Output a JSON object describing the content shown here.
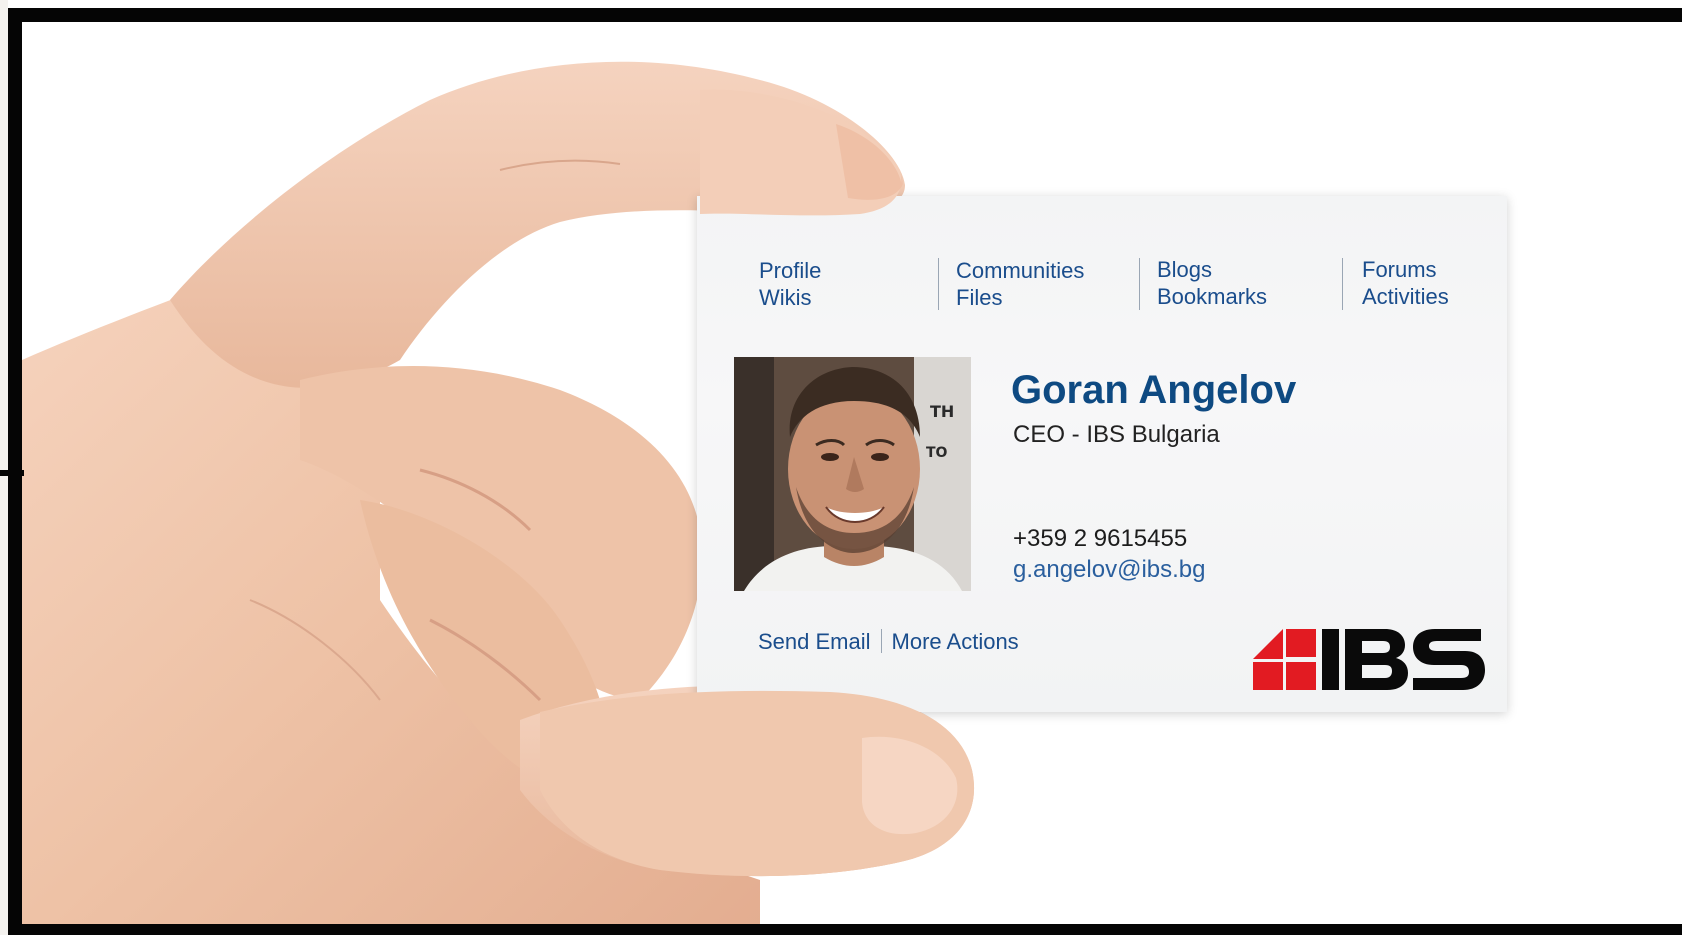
{
  "card": {
    "nav_links": [
      {
        "label": "Profile"
      },
      {
        "label": "Wikis"
      },
      {
        "label": "Communities"
      },
      {
        "label": "Files"
      },
      {
        "label": "Blogs"
      },
      {
        "label": "Bookmarks"
      },
      {
        "label": "Forums"
      },
      {
        "label": "Activities"
      }
    ],
    "person": {
      "name": "Goran Angelov",
      "title": "CEO - IBS Bulgaria",
      "phone": "+359 2 9615455",
      "email": "g.angelov@ibs.bg",
      "photo_icon": "person-photo"
    },
    "actions": {
      "send_email": "Send Email",
      "more_actions": "More Actions"
    },
    "logo": {
      "text": "IBS",
      "colors": {
        "mark": "#e21b22",
        "text": "#0a0a0a"
      }
    }
  },
  "colors": {
    "link": "#1a4d8c",
    "name": "#0e4a82",
    "frame": "#050505",
    "skin": "#f0c7ad"
  }
}
